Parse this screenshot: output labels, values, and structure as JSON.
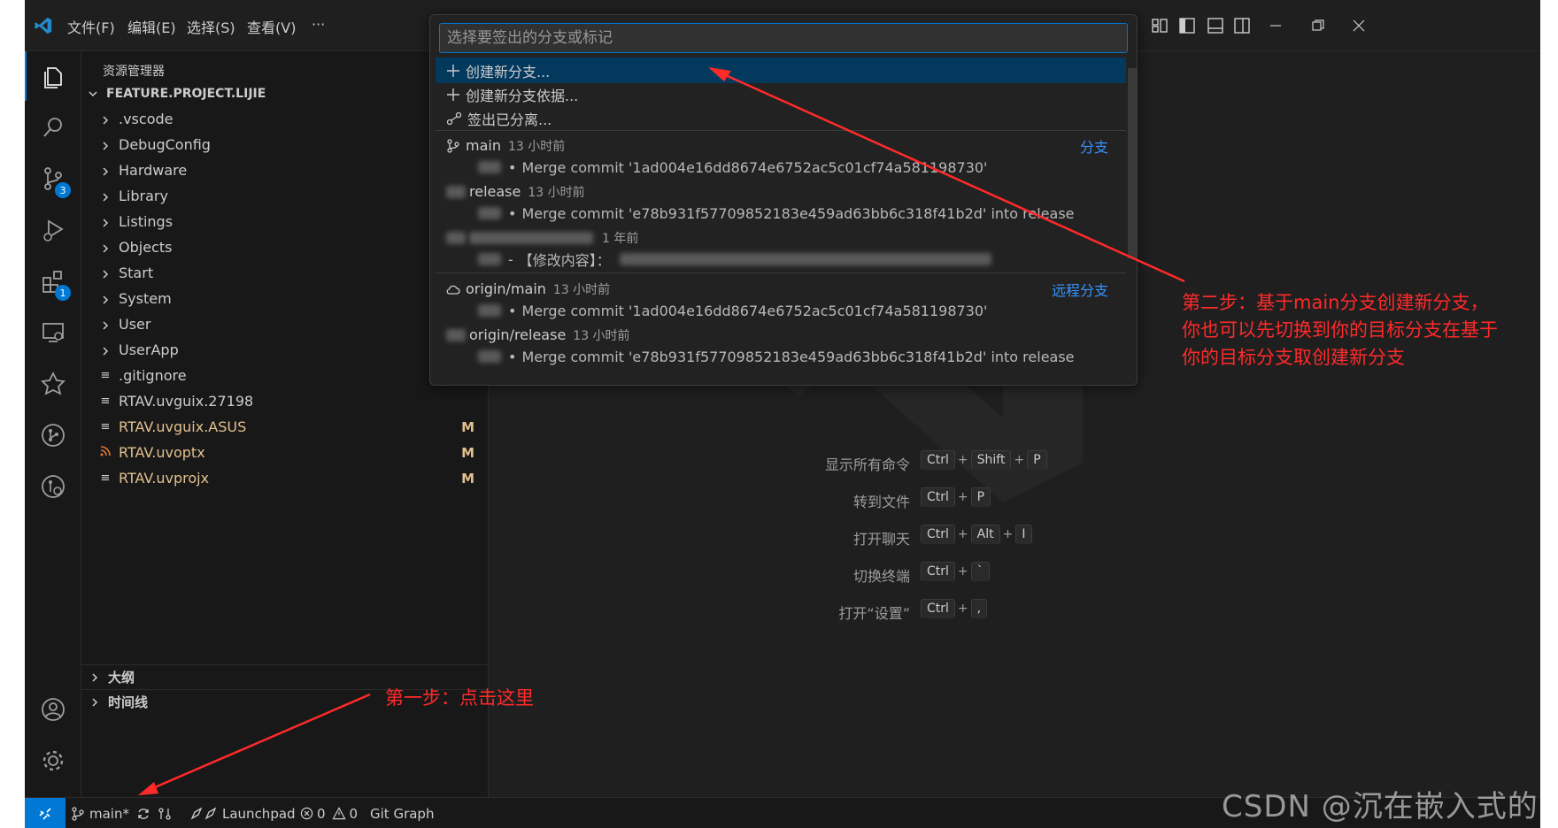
{
  "menu": {
    "file": "文件(F)",
    "edit": "编辑(E)",
    "selection": "选择(S)",
    "view": "查看(V)",
    "more": "···"
  },
  "activity": {
    "scm_badge": "3",
    "ext_badge": "1"
  },
  "sidebar": {
    "title": "资源管理器",
    "root": "FEATURE.PROJECT.LIJIE",
    "folders": [
      ".vscode",
      "DebugConfig",
      "Hardware",
      "Library",
      "Listings",
      "Objects",
      "Start",
      "System",
      "User",
      "UserApp"
    ],
    "files": [
      {
        "name": ".gitignore",
        "status": "",
        "color": "#cccccc",
        "icon": "≡"
      },
      {
        "name": "RTAV.uvguix.27198",
        "status": "",
        "color": "#cccccc",
        "icon": "≡"
      },
      {
        "name": "RTAV.uvguix.ASUS",
        "status": "M",
        "color": "#e2c08d",
        "icon": "≡"
      },
      {
        "name": "RTAV.uvoptx",
        "status": "M",
        "color": "#e2c08d",
        "icon": "rss"
      },
      {
        "name": "RTAV.uvprojx",
        "status": "M",
        "color": "#e2c08d",
        "icon": "≡"
      }
    ],
    "outline": "大纲",
    "timeline": "时间线"
  },
  "quickpick": {
    "placeholder": "选择要签出的分支或标记",
    "actions": [
      {
        "icon": "+",
        "label": "创建新分支..."
      },
      {
        "icon": "+",
        "label": "创建新分支依据..."
      },
      {
        "icon": "detach",
        "label": "签出已分离..."
      }
    ],
    "branches": [
      {
        "name": "main",
        "time": "13 小时前",
        "desc": "Merge commit '1ad004e16dd8674e6752ac5c01cf74a581198730'",
        "group": "分支"
      },
      {
        "name": "release",
        "time": "13 小时前",
        "desc": "Merge commit 'e78b931f57709852183e459ad63bb6c318f41b2d' into release",
        "group": ""
      },
      {
        "name": "",
        "time": "1 年前",
        "desc": "【修改内容】：",
        "group": ""
      }
    ],
    "remotes": [
      {
        "name": "origin/main",
        "time": "13 小时前",
        "desc": "Merge commit '1ad004e16dd8674e6752ac5c01cf74a581198730'",
        "group": "远程分支"
      },
      {
        "name": "origin/release",
        "time": "13 小时前",
        "desc": "Merge commit 'e78b931f57709852183e459ad63bb6c318f41b2d' into release",
        "group": ""
      }
    ]
  },
  "shortcuts": [
    {
      "label": "显示所有命令",
      "keys": [
        "Ctrl",
        "Shift",
        "P"
      ]
    },
    {
      "label": "转到文件",
      "keys": [
        "Ctrl",
        "P"
      ]
    },
    {
      "label": "打开聊天",
      "keys": [
        "Ctrl",
        "Alt",
        "I"
      ]
    },
    {
      "label": "切换终端",
      "keys": [
        "Ctrl",
        "`"
      ]
    },
    {
      "label": "打开“设置”",
      "keys": [
        "Ctrl",
        ","
      ]
    }
  ],
  "statusbar": {
    "branch": "main*",
    "launchpad": "Launchpad",
    "errors": "0",
    "warnings": "0",
    "gitgraph": "Git Graph"
  },
  "annotations": {
    "step1": "第一步：点击这里",
    "step2_line1": "第二步：基于main分支创建新分支，",
    "step2_line2": "你也可以先切换到你的目标分支在基于",
    "step2_line3": "你的目标分支取创建新分支"
  },
  "watermark": "CSDN @沉在嵌入式的鱼",
  "colors": {
    "accent": "#0078d4",
    "modified": "#e2c08d",
    "annotation": "#ff2a2a",
    "selection": "#04395e"
  }
}
